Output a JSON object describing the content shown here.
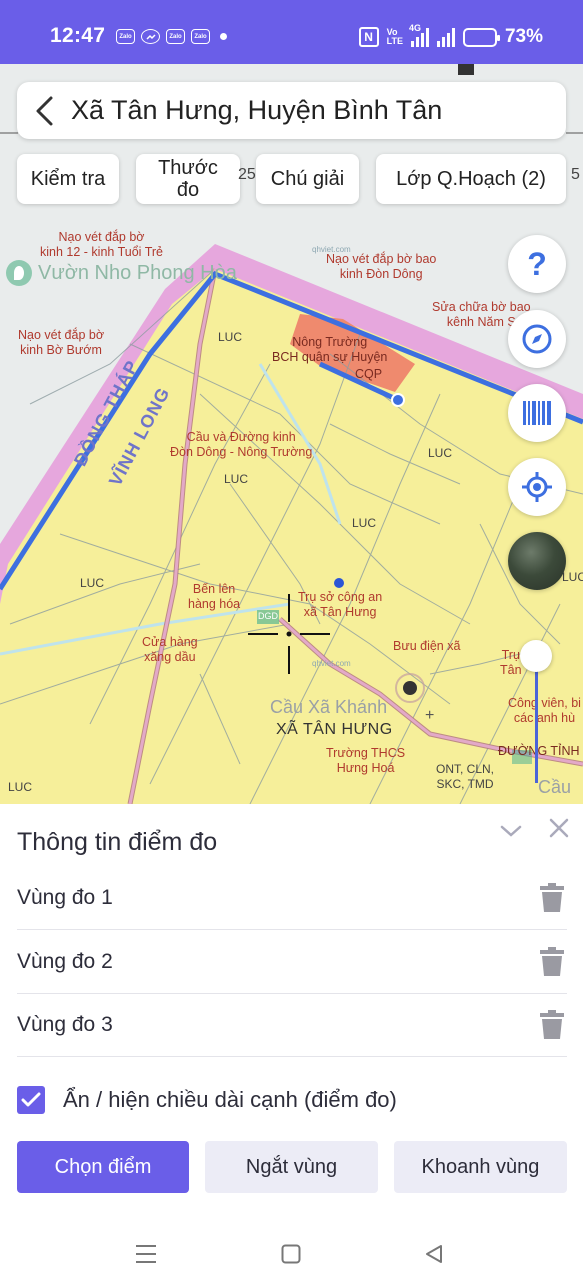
{
  "status_bar": {
    "time": "12:47",
    "app_icons": [
      "Zalo",
      "messenger",
      "Zalo",
      "Zalo"
    ],
    "nfc": "N",
    "volte_1": "Vo",
    "volte_2": "LTE",
    "network": "4G",
    "battery": "73%",
    "battery_level": 0.73
  },
  "header": {
    "title": "Xã Tân Hưng, Huyện Bình Tân"
  },
  "toolbar": {
    "check_label": "Kiểm tra",
    "ruler_label_1": "Thước",
    "ruler_label_2": "đo",
    "scale_left": "25",
    "legend_label": "Chú giải",
    "layer_label": "Lớp Q.Hoạch (2)",
    "scale_right": "5"
  },
  "map": {
    "labels": {
      "nao_vet_kinh12": "Nạo vét đắp bờ\nkinh 12 - kinh Tuổi Trẻ",
      "vuon_nho": "Vườn Nho Phong Hòa",
      "nao_vet_don_dong": "Nạo vét đắp bờ bao\nkinh Đòn Dông",
      "sua_chua_nam": "Sửa chữa bờ bao\nkênh Năm S",
      "nao_vet_bo_buom": "Nạo vét đắp bờ\nkinh Bờ Bướm",
      "nong_truong": "Nông Trường\nBCH quân sự Huyện",
      "cqp": "CQP",
      "cau_don_dong": "Cầu và Đường kinh\nĐòn Dông - Nông Trường",
      "dong_thap": "ĐỒNG THÁP",
      "vinh_long": "VĨNH LONG",
      "ben_len": "Bến lên\nhàng hóa",
      "tru_so": "Trụ sở công an\nxã Tân Hưng",
      "cua_hang": "Cửa hàng\nxăng dầu",
      "buu_dien": "Bưu điện xã",
      "tru_tan_hung": "Trụ\nTân",
      "cong_vien": "Công viên, bi\ncác anh hù",
      "cau_xa_khanh": "Cầu Xã Khánh",
      "xa_tan_hung": "XÃ TÂN HƯNG",
      "truong_thcs": "Trường THCS\nHưng Hoá",
      "duong_tinh": "ĐƯỜNG TỈNH 8",
      "ont": "ONT, CLN,\nSKC, TMD",
      "cau_right": "Cầu",
      "dot_code": "DGD",
      "watermark": "qhviet.com",
      "luc": "LUC"
    }
  },
  "panel": {
    "title": "Thông tin điểm đo",
    "zones": [
      {
        "label": "Vùng đo 1"
      },
      {
        "label": "Vùng đo 2"
      },
      {
        "label": "Vùng đo 3"
      }
    ],
    "toggle_label": "Ẩn / hiện chiều dài cạnh (điểm đo)",
    "toggle_checked": true,
    "buttons": {
      "select_point": "Chọn điểm",
      "break_zone": "Ngắt vùng",
      "draw_zone": "Khoanh vùng"
    }
  },
  "colors": {
    "accent": "#6a5ee8",
    "boundary": "#3d6fe0",
    "land_yellow": "#f6ef9a",
    "cqp_red": "#ef8a6e",
    "border_pink": "#e6a7dd"
  }
}
